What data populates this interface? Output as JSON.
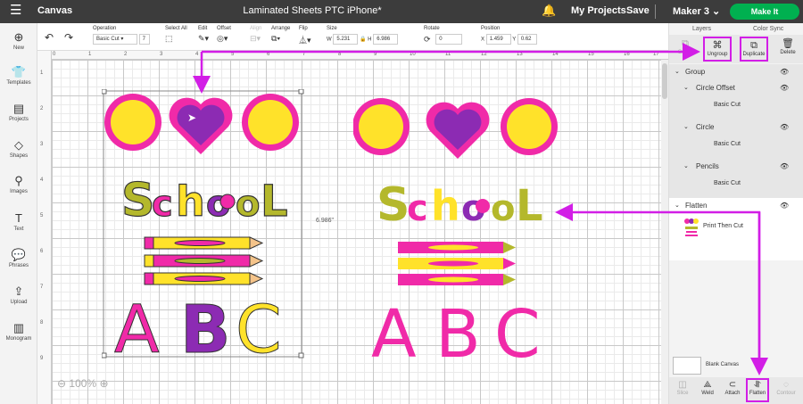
{
  "topbar": {
    "menu_icon": "☰",
    "section": "Canvas",
    "title": "Laminated Sheets PTC iPhone*",
    "bell_icon": "🔔",
    "my_projects": "My Projects",
    "save": "Save",
    "machine": "Maker 3",
    "machine_chevron": "⌄",
    "make_it": "Make It"
  },
  "leftbar": {
    "items": [
      {
        "label": "New",
        "icon": "⊕"
      },
      {
        "label": "Templates",
        "icon": "👕"
      },
      {
        "label": "Projects",
        "icon": "▤"
      },
      {
        "label": "Shapes",
        "icon": "◇"
      },
      {
        "label": "Images",
        "icon": "⚲"
      },
      {
        "label": "Text",
        "icon": "T"
      },
      {
        "label": "Phrases",
        "icon": "💬"
      },
      {
        "label": "Upload",
        "icon": "⇪"
      },
      {
        "label": "Monogram",
        "icon": "▥"
      }
    ]
  },
  "toolbar": {
    "undo": "↶",
    "redo": "↷",
    "operation_label": "Operation",
    "operation_value": "Basic Cut",
    "operation_chevron": "▾",
    "layer_count": "7",
    "select_all_label": "Select All",
    "edit_label": "Edit",
    "offset_label": "Offset",
    "align_label": "Align",
    "arrange_label": "Arrange",
    "flip_label": "Flip",
    "size_label": "Size",
    "w_label": "W",
    "w_value": "5.231",
    "h_label": "H",
    "h_value": "6.986",
    "rotate_label": "Rotate",
    "rotate_value": "0",
    "position_label": "Position",
    "x_label": "X",
    "x_value": "1.459",
    "y_label": "Y",
    "y_value": "0.62"
  },
  "canvas": {
    "ruler_top": [
      "0",
      "1",
      "2",
      "3",
      "4",
      "5",
      "6",
      "7",
      "8",
      "9",
      "10",
      "11",
      "12",
      "13",
      "14",
      "15",
      "16",
      "17"
    ],
    "ruler_left": [
      "1",
      "2",
      "3",
      "4",
      "5",
      "6",
      "7",
      "8",
      "9"
    ],
    "zoom": "100%",
    "zoom_out": "⊖",
    "zoom_in": "⊕",
    "height_readout": "6.986\"",
    "school_word": [
      "S",
      "c",
      "h",
      "o",
      "o",
      "L"
    ],
    "abc": [
      "A",
      "B",
      "C"
    ]
  },
  "right_panel": {
    "tab_layers": "Layers",
    "tab_color_sync": "Color Sync",
    "actions": [
      {
        "label": "Group",
        "icon": "⧉",
        "dim": true
      },
      {
        "label": "Ungroup",
        "icon": "⌘",
        "dim": false
      },
      {
        "label": "Duplicate",
        "icon": "⧉",
        "dim": false
      },
      {
        "label": "Delete",
        "icon": "🗑",
        "dim": false
      }
    ],
    "layers": {
      "group": "Group",
      "circle_offset": "Circle Offset",
      "circle_offset_sub": "Basic Cut",
      "circle": "Circle",
      "circle_sub": "Basic Cut",
      "pencils": "Pencils",
      "pencils_sub": "Basic Cut",
      "flatten": "Flatten",
      "flatten_sub": "Print Then Cut"
    },
    "blank_canvas": "Blank Canvas",
    "bottom": [
      {
        "label": "Slice",
        "icon": "◫",
        "dim": true
      },
      {
        "label": "Weld",
        "icon": "⟁",
        "dim": false
      },
      {
        "label": "Attach",
        "icon": "⊂",
        "dim": false
      },
      {
        "label": "Flatten",
        "icon": "⥯",
        "dim": false
      },
      {
        "label": "Contour",
        "icon": "◌",
        "dim": true
      }
    ]
  },
  "colors": {
    "pink": "#f02aa8",
    "purple": "#8c2bb3",
    "yellow": "#ffe22a",
    "olive": "#b4b82c",
    "magenta_arrow": "#d21ee6",
    "make_it_green": "#00b050"
  }
}
